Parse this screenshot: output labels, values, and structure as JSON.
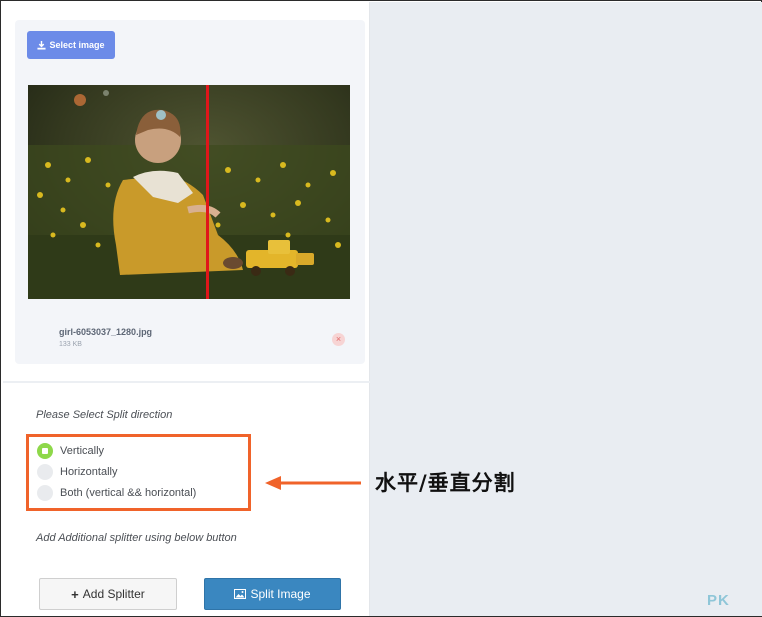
{
  "upload": {
    "select_label": "Select image",
    "file_name": "girl-6053037_1280.jpg",
    "file_size": "133 KB",
    "remove_symbol": "×"
  },
  "split": {
    "prompt": "Please Select Split direction",
    "options": [
      {
        "label": "Vertically",
        "checked": true
      },
      {
        "label": "Horizontally",
        "checked": false
      },
      {
        "label": "Both (vertical && horizontal)",
        "checked": false
      }
    ],
    "hint": "Add Additional splitter using below button"
  },
  "buttons": {
    "add_label": "Add Splitter",
    "split_label": "Split Image"
  },
  "annotation": {
    "text": "水平/垂直分割"
  },
  "watermark": "PK",
  "colors": {
    "accent_orange": "#f0632a",
    "select_button": "#6c8be8",
    "split_button": "#3a87c0",
    "radio_checked": "#8ed84a",
    "split_line": "#e0161a"
  },
  "icons": {
    "select": "upload-icon",
    "add": "plus-icon",
    "split": "image-icon",
    "arrow": "arrow-left-icon"
  }
}
